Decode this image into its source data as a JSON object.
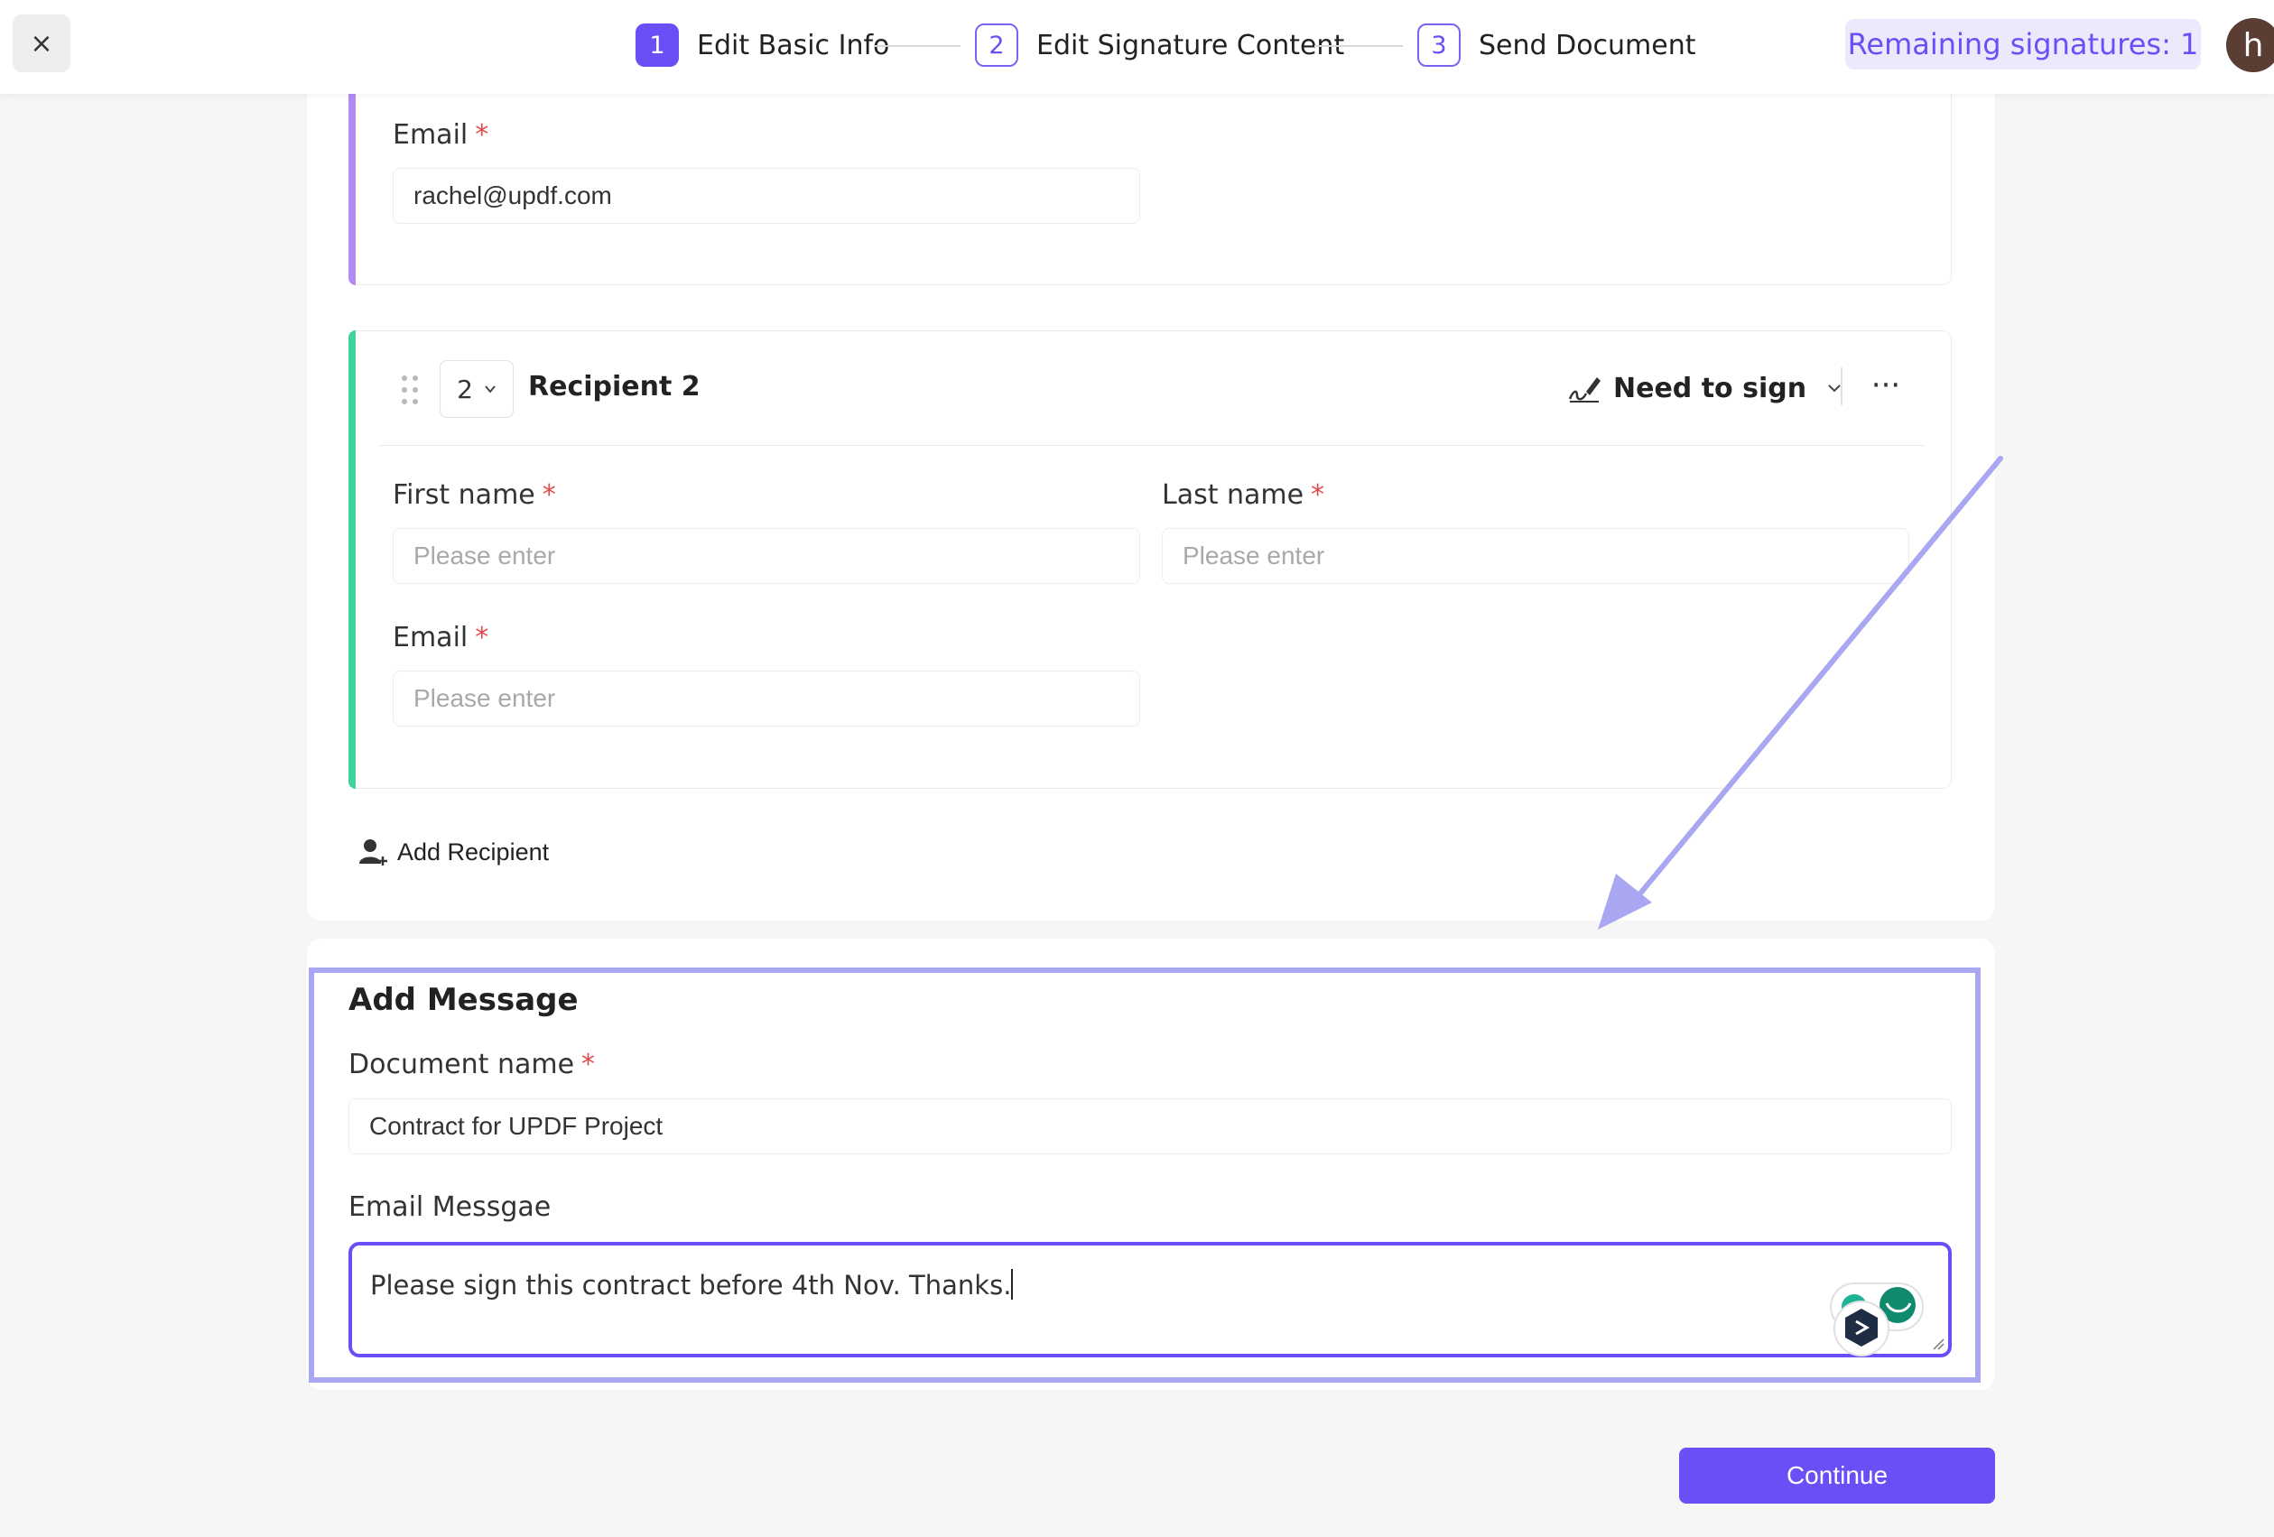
{
  "header": {
    "close_symbol": "×",
    "steps": [
      {
        "number": "1",
        "label": "Edit Basic Info",
        "state": "active"
      },
      {
        "number": "2",
        "label": "Edit Signature Content",
        "state": "inactive"
      },
      {
        "number": "3",
        "label": "Send Document",
        "state": "inactive"
      }
    ],
    "remaining_signatures": "Remaining signatures: 1",
    "avatar_initial": "h"
  },
  "recipient1": {
    "email_label": "Email",
    "required_mark": "*",
    "email_value": "rachel@updf.com",
    "accent_color": "#b58af0"
  },
  "recipient2": {
    "order": "2",
    "title": "Recipient 2",
    "role": "Need to sign",
    "more_symbol": "···",
    "first_name_label": "First name",
    "last_name_label": "Last name",
    "email_label": "Email",
    "required_mark": "*",
    "first_name_placeholder": "Please enter",
    "last_name_placeholder": "Please enter",
    "email_placeholder": "Please enter",
    "accent_color": "#3ed39a"
  },
  "add_recipient": {
    "label": "Add Recipient",
    "icon": "add-user-icon"
  },
  "message": {
    "title": "Add Message",
    "document_name_label": "Document name",
    "required_mark": "*",
    "document_name_value": "Contract for UPDF Project",
    "email_message_label": "Email Messgae",
    "email_message_value": "Please sign this contract before 4th Nov. Thanks."
  },
  "footer": {
    "continue_label": "Continue"
  },
  "colors": {
    "accent": "#6b4ef6",
    "highlight": "#a9a7f2",
    "required": "#e04a4a"
  }
}
